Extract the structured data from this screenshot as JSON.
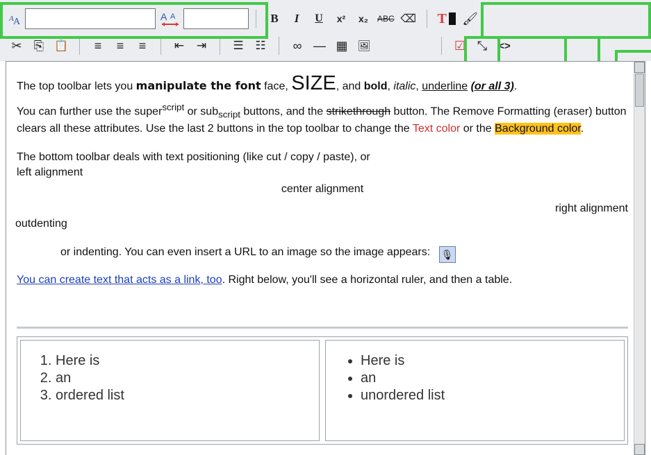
{
  "toolbar": {
    "font_face": {
      "value": "",
      "placeholder": ""
    },
    "font_size": {
      "value": "",
      "placeholder": ""
    },
    "buttons": {
      "bold": "B",
      "italic": "I",
      "underline": "U",
      "superscript": "x²",
      "subscript": "x₂",
      "strikethrough": "ABC",
      "remove_formatting": "⌫",
      "text_color": "T",
      "background_color": "🖌",
      "cut": "✂",
      "copy": "⎘",
      "paste": "📋",
      "align_left": "≡",
      "align_center": "≡",
      "align_right": "≡",
      "outdent": "⇤",
      "indent": "⇥",
      "ordered_list": "☰",
      "unordered_list": "☷",
      "link": "∞",
      "hr": "—",
      "table": "▦",
      "image": "🖼",
      "spellcheck": "☑",
      "resize": "⤡",
      "source": "<>"
    }
  },
  "content": {
    "p1_a": "The top toolbar lets you ",
    "p1_b": "manipulate the font",
    "p1_c": " face, ",
    "p1_d": "SIZE",
    "p1_e": ", and ",
    "p1_f": "bold",
    "p1_g": ", ",
    "p1_h": "italic",
    "p1_i": ", ",
    "p1_j": "underline",
    "p1_k": " ",
    "p1_l": "(or all 3)",
    "p1_m": ".",
    "p2_a": "You can further use the super",
    "p2_b": "script",
    "p2_c": " or sub",
    "p2_d": "script",
    "p2_e": " buttons, and the ",
    "p2_f": "strikethrough",
    "p2_g": " button.  The Remove Formatting (eraser) button clears all these attributes.  Use the last 2 buttons in the top toolbar to change the ",
    "p2_h": "Text color",
    "p2_i": " or the ",
    "p2_j": "Background color",
    "p2_k": ".",
    "p3": "The bottom toolbar deals with text positioning (like cut / copy / paste), or",
    "p4": "left alignment",
    "p5": "center alignment",
    "p6": "right alignment",
    "p7": "outdenting",
    "p8": "or indenting.  You can even insert a URL to an image so the image appears:",
    "link_text": "You can create text that acts as a link, too",
    "after_link": ".  Right below, you'll see a horizontal ruler, and then a table.",
    "ordered": [
      "Here is",
      "an",
      "ordered list"
    ],
    "unordered": [
      "Here is",
      "an",
      "unordered list"
    ]
  },
  "colors": {
    "highlight": "#43c94a",
    "text_red": "#d02f2f",
    "bg_yellow": "#ffc21a",
    "link_blue": "#1d40b8"
  }
}
